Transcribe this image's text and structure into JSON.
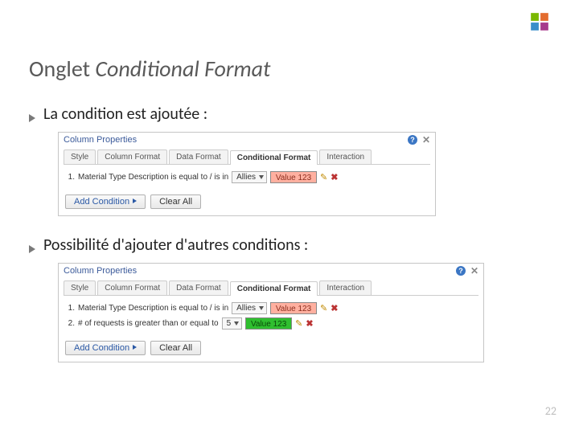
{
  "title": {
    "plain": "Onglet ",
    "italic": "Conditional Format"
  },
  "bullets": [
    "La condition est ajoutée :",
    "Possibilité d'ajouter d'autres conditions :"
  ],
  "panel": {
    "header": "Column Properties",
    "help": "?",
    "close": "✕",
    "tabs": [
      "Style",
      "Column Format",
      "Data Format",
      "Conditional Format",
      "Interaction"
    ],
    "activeTab": 3,
    "addBtn": "Add Condition",
    "clearBtn": "Clear All",
    "p1": {
      "r1_idx": "1.",
      "r1_cond": "Material Type Description is equal to / is in",
      "r1_dd": "Allies",
      "r1_sw": "Value 123"
    },
    "p2": {
      "r1_idx": "1.",
      "r1_cond": "Material Type Description is equal to / is in",
      "r1_dd": "Allies",
      "r1_sw": "Value 123",
      "r2_idx": "2.",
      "r2_cond": "# of requests is greater than or equal to",
      "r2_dd": "5",
      "r2_sw": "Value 123"
    }
  },
  "pageNum": "22"
}
